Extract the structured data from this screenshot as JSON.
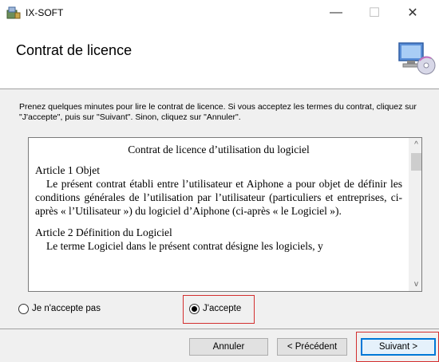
{
  "window": {
    "title": "IX-SOFT",
    "minimize_glyph": "—",
    "maximize_glyph": "☐",
    "close_glyph": "✕"
  },
  "header": {
    "title": "Contrat de licence",
    "graphic_icon": "computer-cd-icon"
  },
  "intro": "Prenez quelques minutes pour lire le contrat de licence. Si vous acceptez les termes du contrat, cliquez sur \"J'accepte\", puis sur \"Suivant\". Sinon, cliquez sur \"Annuler\".",
  "license": {
    "title": "Contrat de licence d’utilisation du logiciel",
    "article1_title": "Article 1  Objet",
    "article1_body": "Le présent contrat établi entre l’utilisateur et Aiphone a pour objet de définir les conditions générales de l’utilisation par l’utilisateur (particuliers et entreprises, ci-après « l’Utilisateur ») du logiciel d’Aiphone (ci-après « le Logiciel »).",
    "article2_title": "Article 2  Définition du Logiciel",
    "article2_body": "Le terme Logiciel dans le présent contrat désigne les logiciels, y",
    "scroll_up_glyph": "^",
    "scroll_down_glyph": "v"
  },
  "options": {
    "decline_label": "Je n'accepte pas",
    "accept_label": "J'accepte",
    "selected": "accept"
  },
  "buttons": {
    "cancel": "Annuler",
    "previous": "< Précédent",
    "next": "Suivant >"
  },
  "colors": {
    "highlight": "#d32f2f",
    "focus": "#0078d7"
  }
}
